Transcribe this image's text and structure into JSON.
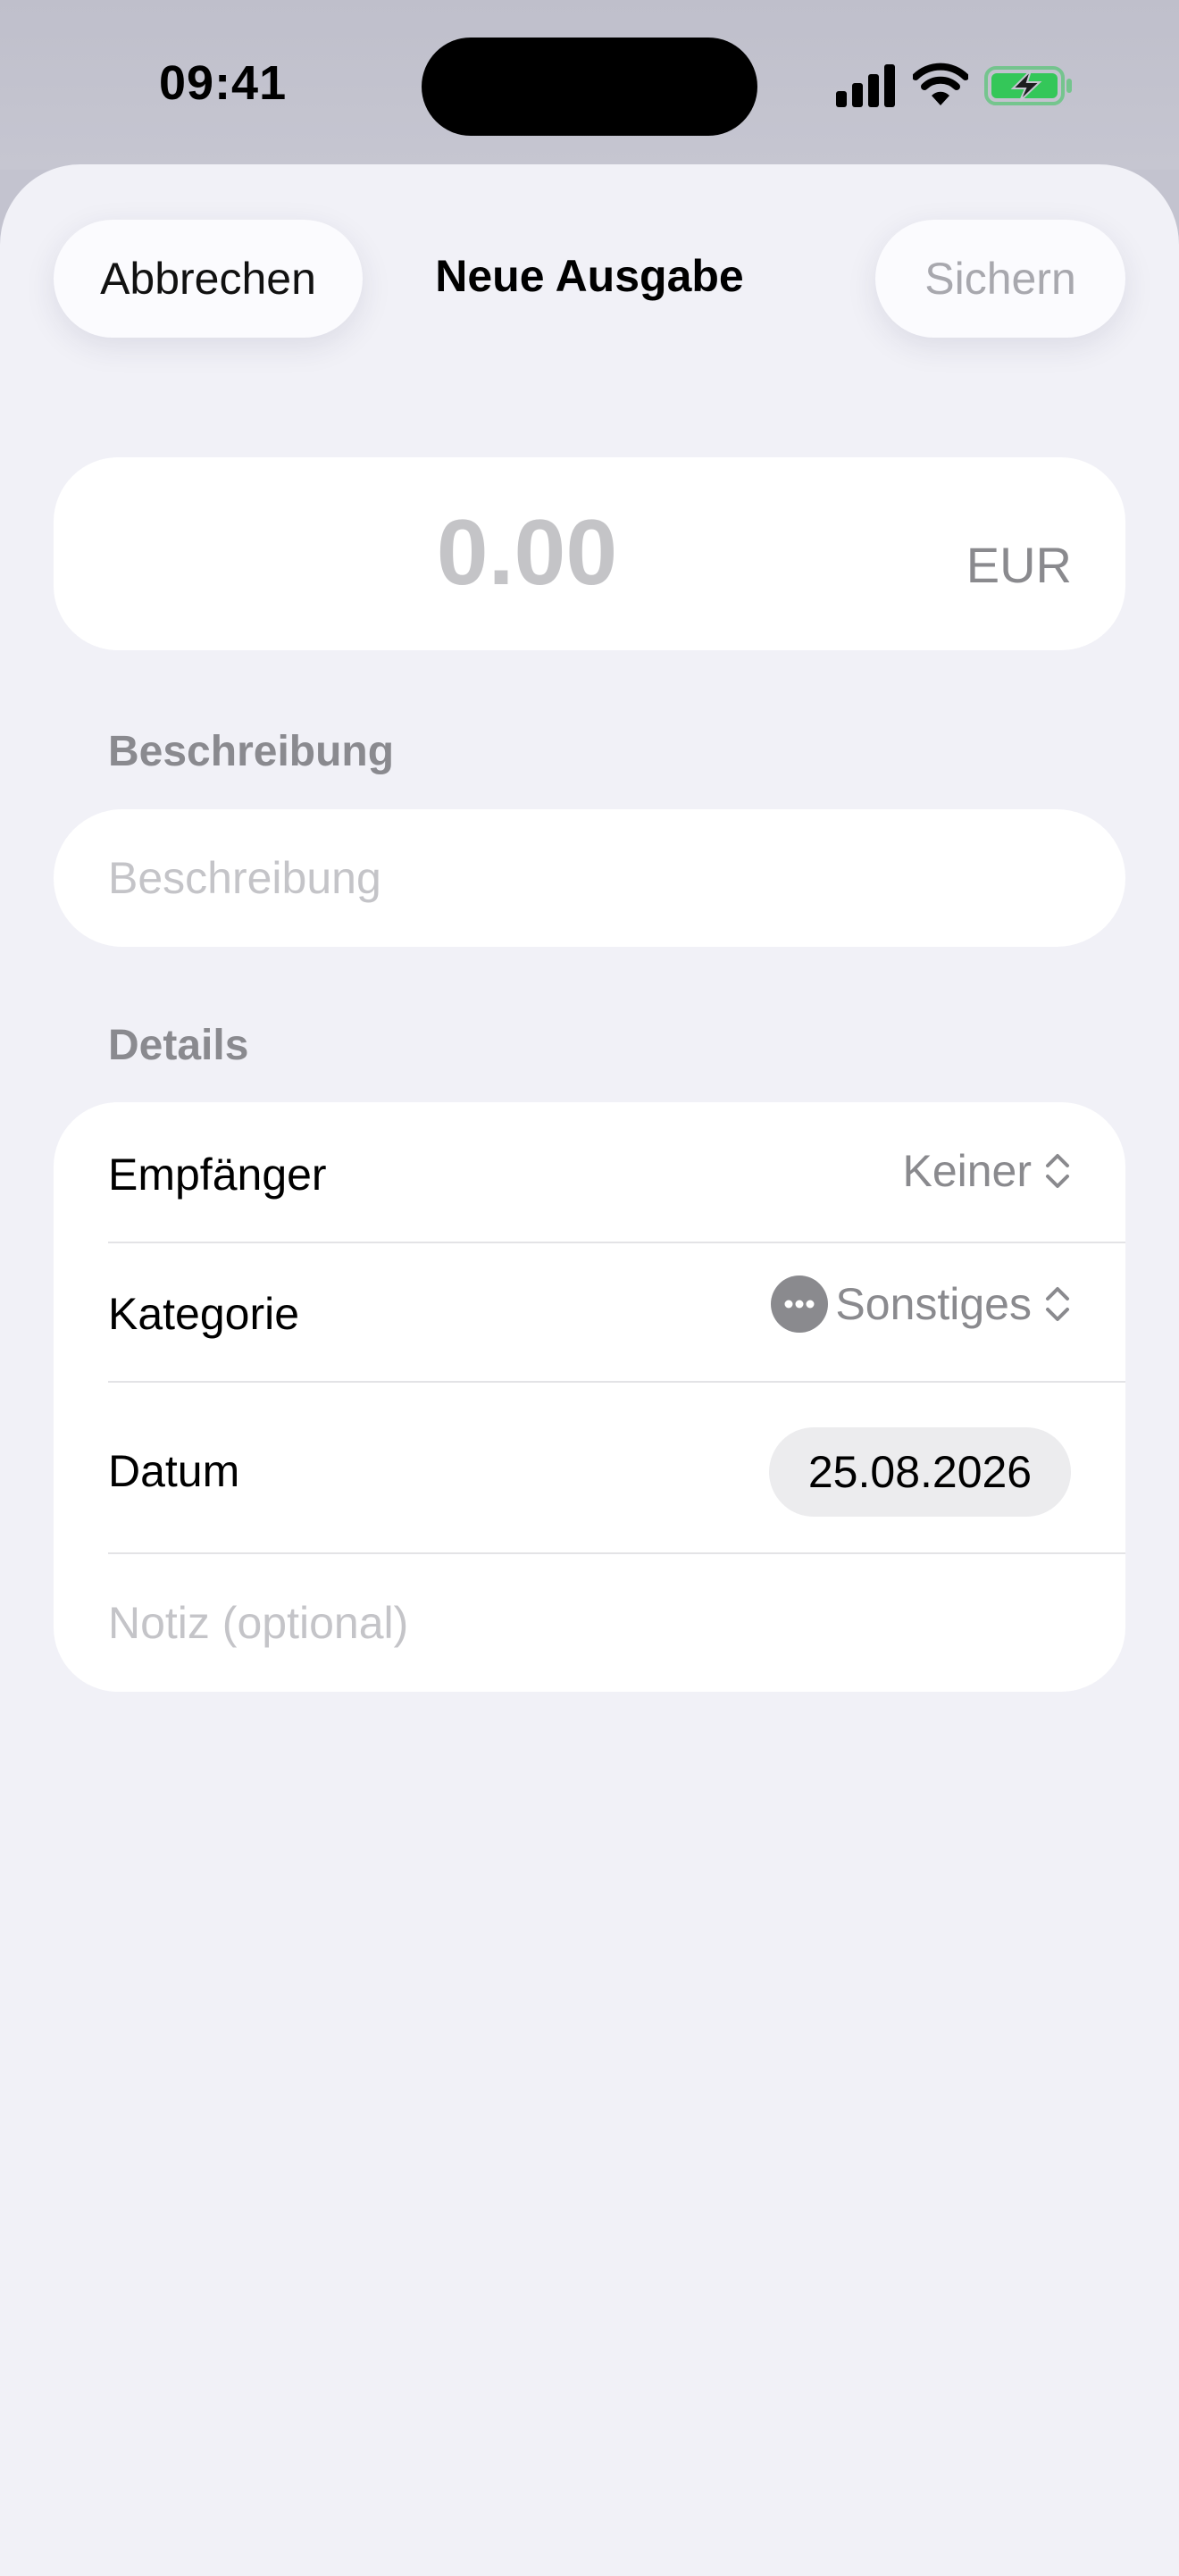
{
  "status_bar": {
    "time": "09:41",
    "signal_icon": "cellular-signal-icon",
    "wifi_icon": "wifi-icon",
    "battery_icon": "battery-charging-icon"
  },
  "nav": {
    "cancel_label": "Abbrechen",
    "title": "Neue Ausgabe",
    "save_label": "Sichern"
  },
  "amount": {
    "value": "0.00",
    "currency": "EUR"
  },
  "description": {
    "section_label": "Beschreibung",
    "placeholder": "Beschreibung",
    "value": ""
  },
  "details": {
    "section_label": "Details",
    "recipient": {
      "label": "Empfänger",
      "value": "Keiner"
    },
    "category": {
      "label": "Kategorie",
      "value": "Sonstiges",
      "icon": "ellipsis-icon"
    },
    "date": {
      "label": "Datum",
      "value": "25.08.2026"
    },
    "note": {
      "placeholder": "Notiz (optional)",
      "value": ""
    }
  },
  "colors": {
    "sheet_background": "#f1f1f7",
    "card_background": "#ffffff",
    "secondary_text": "#8a8a8e",
    "placeholder_text": "#c4c4c8",
    "battery_green": "#34c759"
  }
}
